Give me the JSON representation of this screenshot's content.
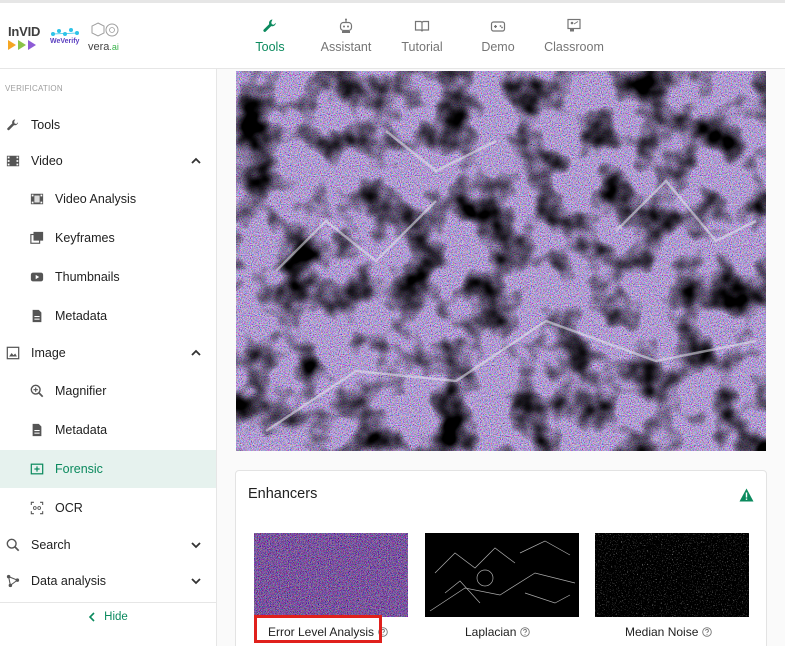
{
  "header": {
    "logos": {
      "invid": "InVID",
      "weverify": "WeVerify",
      "vera_main": "vera",
      "vera_suffix": ".ai"
    },
    "nav": [
      {
        "label": "Tools",
        "icon": "wrench-icon",
        "active": true
      },
      {
        "label": "Assistant",
        "icon": "robot-icon",
        "active": false
      },
      {
        "label": "Tutorial",
        "icon": "book-icon",
        "active": false
      },
      {
        "label": "Demo",
        "icon": "gamepad-icon",
        "active": false
      },
      {
        "label": "Classroom",
        "icon": "classroom-icon",
        "active": false
      }
    ]
  },
  "sidebar": {
    "section_label": "VERIFICATION",
    "items": [
      {
        "label": "Tools",
        "icon": "wrench-icon",
        "level": "top"
      },
      {
        "label": "Video",
        "icon": "film-icon",
        "level": "top",
        "expanded": true
      },
      {
        "label": "Video Analysis",
        "icon": "film-strip-icon",
        "level": "sub"
      },
      {
        "label": "Keyframes",
        "icon": "layers-icon",
        "level": "sub"
      },
      {
        "label": "Thumbnails",
        "icon": "youtube-icon",
        "level": "sub"
      },
      {
        "label": "Metadata",
        "icon": "document-icon",
        "level": "sub"
      },
      {
        "label": "Image",
        "icon": "image-icon",
        "level": "top",
        "expanded": true
      },
      {
        "label": "Magnifier",
        "icon": "magnifier-icon",
        "level": "sub"
      },
      {
        "label": "Metadata",
        "icon": "document-icon",
        "level": "sub"
      },
      {
        "label": "Forensic",
        "icon": "forensic-icon",
        "level": "sub",
        "active": true
      },
      {
        "label": "OCR",
        "icon": "ocr-icon",
        "level": "sub"
      },
      {
        "label": "Search",
        "icon": "search-icon",
        "level": "top",
        "expanded": false
      },
      {
        "label": "Data analysis",
        "icon": "network-icon",
        "level": "top",
        "expanded": false
      }
    ],
    "hide_label": "Hide"
  },
  "main": {
    "enhancers": {
      "title": "Enhancers",
      "filters": [
        {
          "label": "Error Level Analysis",
          "highlighted": true
        },
        {
          "label": "Laplacian",
          "highlighted": false
        },
        {
          "label": "Median Noise",
          "highlighted": false
        }
      ]
    }
  },
  "colors": {
    "accent": "#0b8a5e",
    "active_bg": "#e6f2ee",
    "highlight_border": "#e0201c"
  }
}
